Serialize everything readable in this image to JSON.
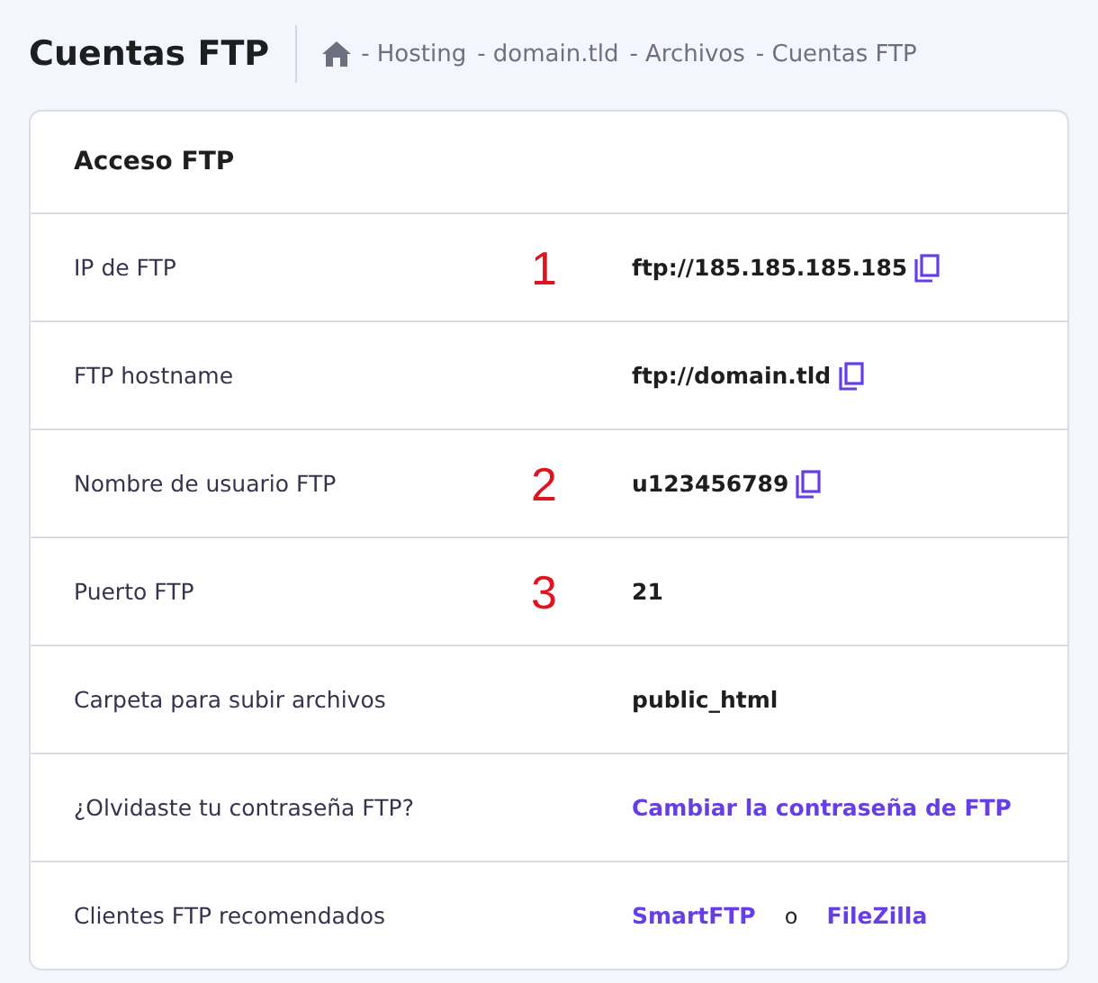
{
  "header": {
    "title": "Cuentas FTP",
    "breadcrumb": [
      "- Hosting",
      "- domain.tld",
      "- Archivos",
      "- Cuentas FTP"
    ]
  },
  "card": {
    "title": "Acceso FTP",
    "rows": [
      {
        "label": "IP de FTP",
        "marker": "1",
        "copy": true,
        "values": [
          {
            "kind": "text",
            "text": "ftp://185.185.185.185"
          }
        ]
      },
      {
        "label": "FTP hostname",
        "copy": true,
        "values": [
          {
            "kind": "text",
            "text": "ftp://domain.tld"
          }
        ]
      },
      {
        "label": "Nombre de usuario FTP",
        "marker": "2",
        "copy": true,
        "values": [
          {
            "kind": "text",
            "text": "u123456789"
          }
        ]
      },
      {
        "label": "Puerto FTP",
        "marker": "3",
        "copy": false,
        "values": [
          {
            "kind": "text",
            "text": "21"
          }
        ]
      },
      {
        "label": "Carpeta para subir archivos",
        "copy": false,
        "values": [
          {
            "kind": "text",
            "text": "public_html"
          }
        ]
      },
      {
        "label": "¿Olvidaste tu contraseña FTP?",
        "copy": false,
        "values": [
          {
            "kind": "link",
            "text": "Cambiar la contraseña de FTP"
          }
        ]
      },
      {
        "label": "Clientes FTP recomendados",
        "copy": false,
        "values": [
          {
            "kind": "link",
            "text": "SmartFTP"
          },
          {
            "kind": "separator",
            "text": "o"
          },
          {
            "kind": "link",
            "text": "FileZilla"
          }
        ]
      }
    ]
  }
}
